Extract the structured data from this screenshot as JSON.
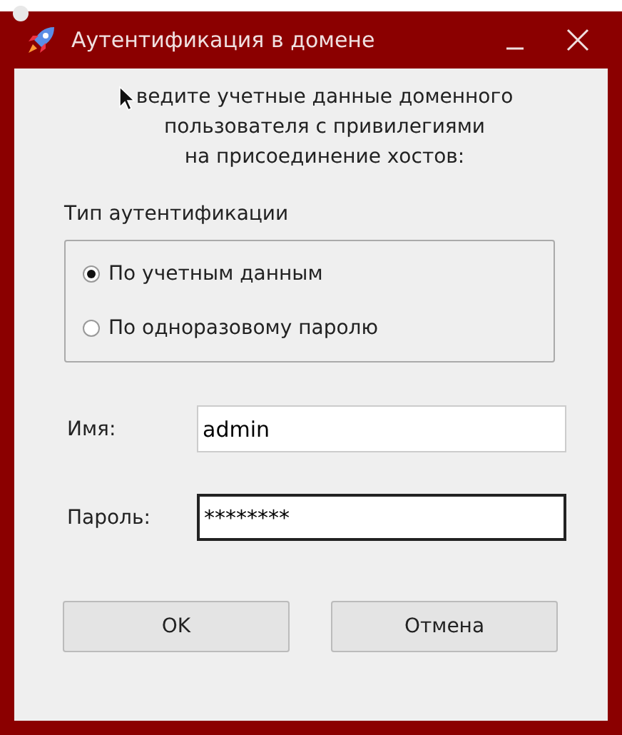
{
  "window": {
    "title": "Аутентификация в домене"
  },
  "intro": "ведите учетные данные доменного\nпользователя с привилегиями\nна присоединение хостов:",
  "auth_type": {
    "label": "Тип аутентификации",
    "options": [
      {
        "label": "По учетным данным",
        "selected": true
      },
      {
        "label": "По одноразовому паролю",
        "selected": false
      }
    ]
  },
  "fields": [
    {
      "label": "Имя:",
      "value": "admin",
      "focused": false
    },
    {
      "label": "Пароль:",
      "value": "********",
      "focused": true
    }
  ],
  "buttons": [
    "OK",
    "Отмена"
  ]
}
